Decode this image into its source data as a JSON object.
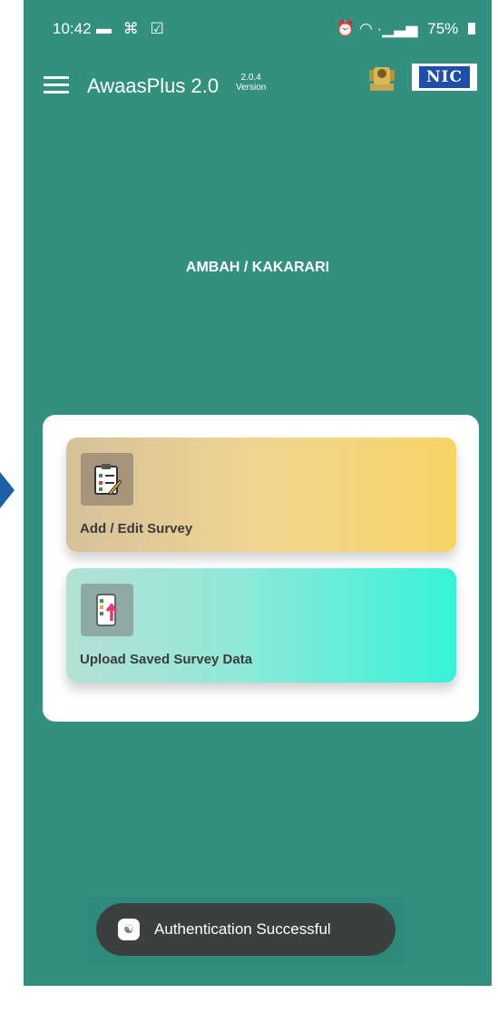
{
  "status_bar": {
    "time": "10:42",
    "left_icons": "▬ ⌘ ☑",
    "right_icons": "⏰ ◠ ·▁▃▅",
    "battery": "75%"
  },
  "app_bar": {
    "title": "AwaasPlus 2.0",
    "version_number": "2.0.4",
    "version_label": "Version",
    "nic_logo_text": "NIC"
  },
  "location": "AMBAH / KAKARARI",
  "actions": [
    {
      "label": "Add / Edit Survey",
      "icon": "survey-clipboard-icon"
    },
    {
      "label": "Upload Saved Survey Data",
      "icon": "upload-phone-icon"
    }
  ],
  "toast": {
    "message": "Authentication Successful",
    "icon": "app-icon"
  },
  "colors": {
    "background": "#338f7e",
    "survey_gradient_end": "#f8d465",
    "upload_gradient_end": "#36f2d8",
    "toast": "#3b3f3e"
  }
}
